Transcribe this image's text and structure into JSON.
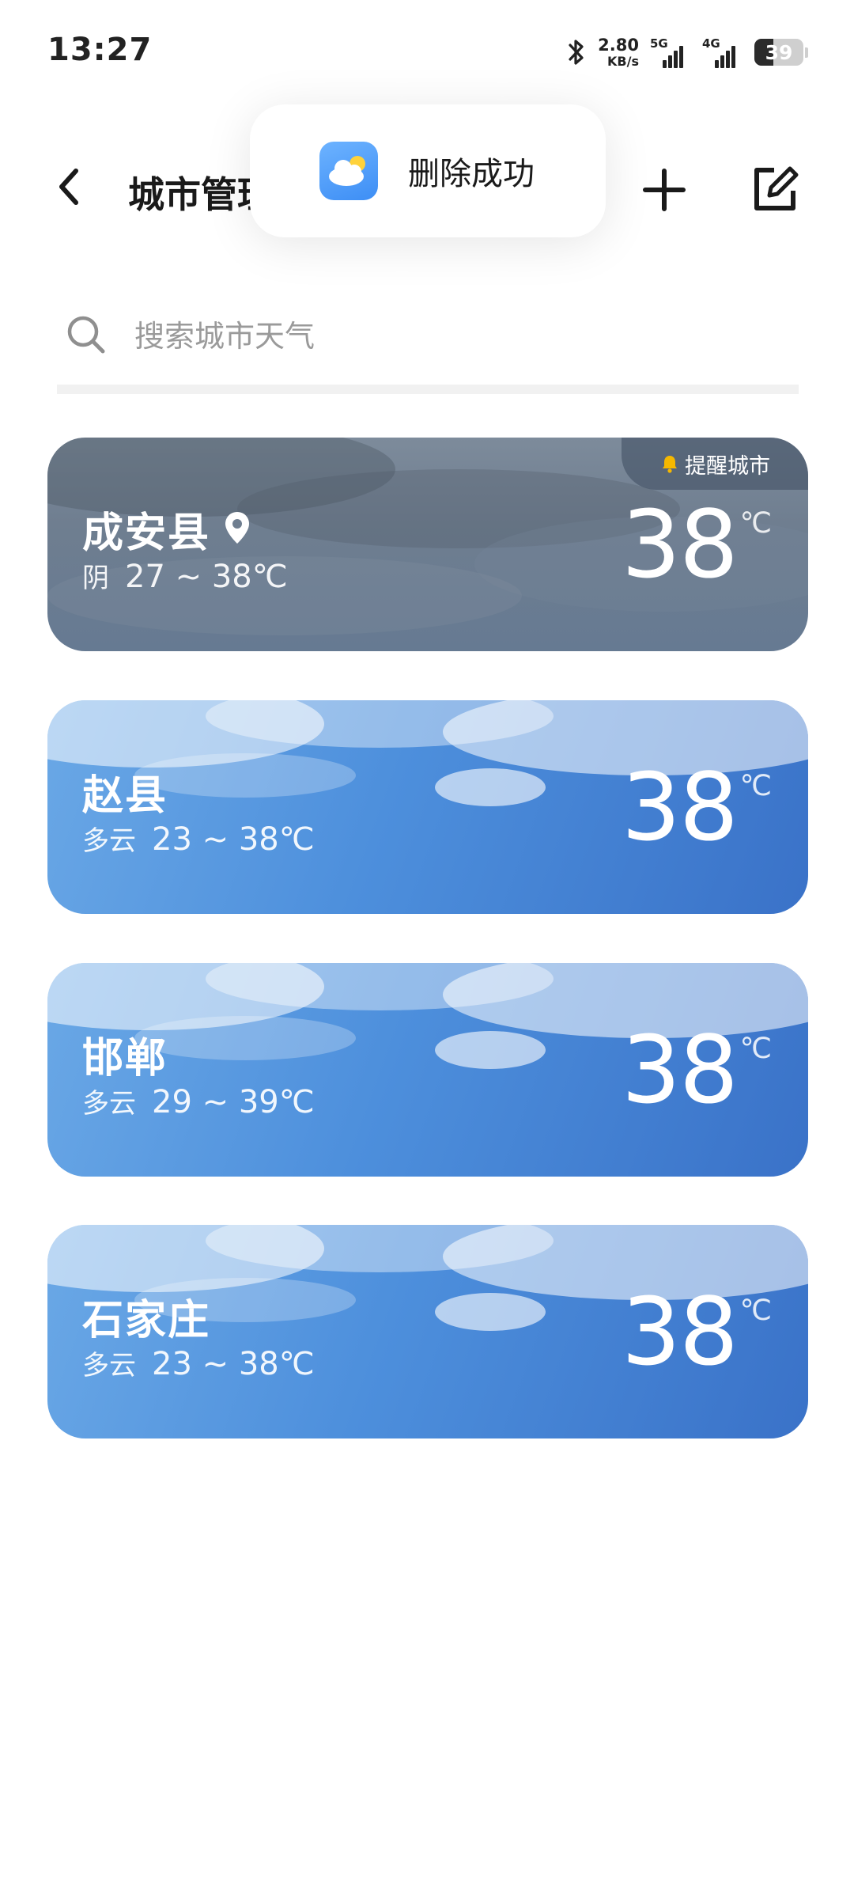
{
  "status_bar": {
    "time": "13:27",
    "net_speed_value": "2.80",
    "net_speed_unit": "KB/s",
    "signal_1_label": "5G",
    "signal_2_label": "4G",
    "battery_level": "39",
    "icons": [
      "bluetooth-icon",
      "signal-icon",
      "battery-icon"
    ]
  },
  "header": {
    "title": "城市管理",
    "back_icon": "chevron-left-icon",
    "add_icon": "plus-icon",
    "edit_icon": "edit-icon"
  },
  "toast": {
    "text": "删除成功",
    "icon": "weather-app-icon"
  },
  "search": {
    "placeholder": "搜索城市天气",
    "value": ""
  },
  "cities": [
    {
      "name": "成安县",
      "condition": "阴",
      "range": "27 ~ 38℃",
      "temp": "38",
      "unit": "℃",
      "is_location": true,
      "badge": "提醒城市",
      "style": "overcast"
    },
    {
      "name": "赵县",
      "condition": "多云",
      "range": "23 ~ 38℃",
      "temp": "38",
      "unit": "℃",
      "style": "cloudy"
    },
    {
      "name": "邯郸",
      "condition": "多云",
      "range": "29 ~ 39℃",
      "temp": "38",
      "unit": "℃",
      "style": "cloudy"
    },
    {
      "name": "石家庄",
      "condition": "多云",
      "range": "23 ~ 38℃",
      "temp": "38",
      "unit": "℃",
      "style": "cloudy"
    }
  ],
  "colors": {
    "overcast_card": "#6f7e90",
    "cloudy_card": "#4d8fdc",
    "badge_bell": "#f5b800",
    "toast_icon": "#4a9af7"
  }
}
